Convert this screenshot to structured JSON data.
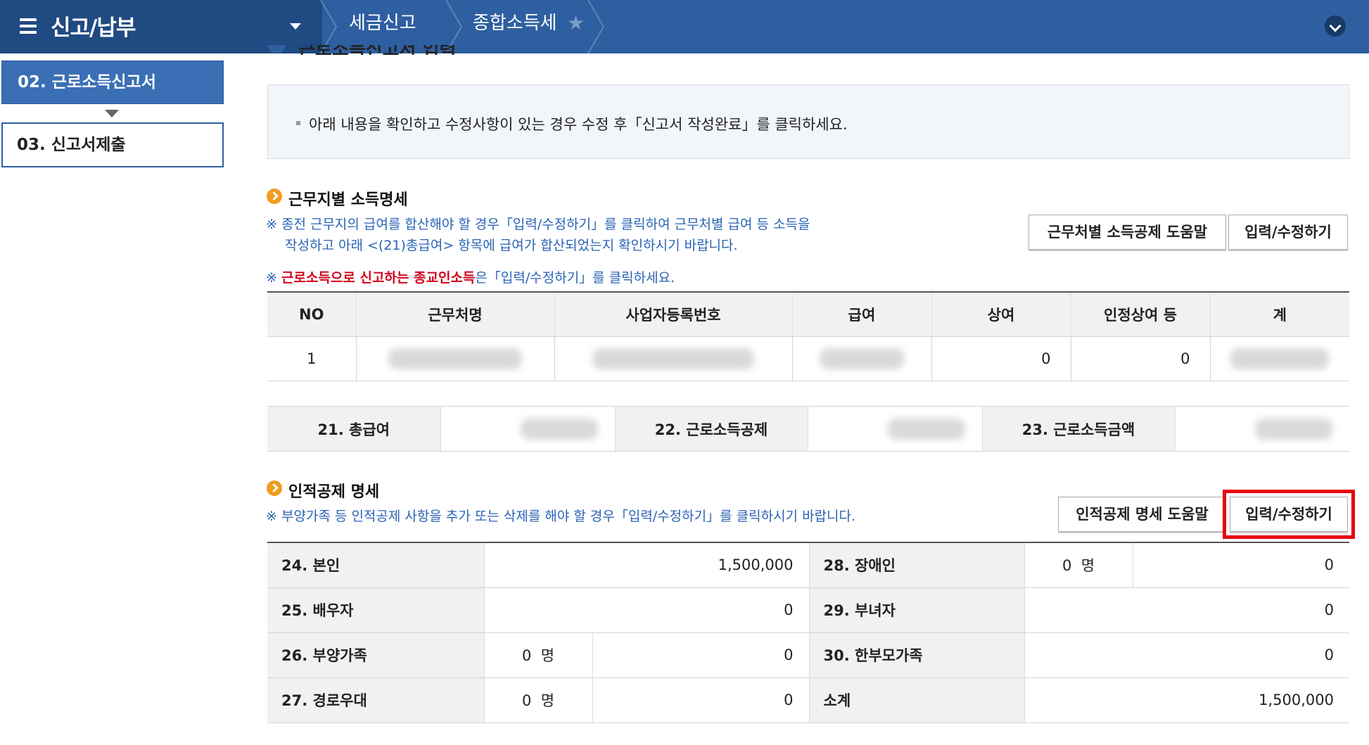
{
  "header": {
    "title": "신고/납부",
    "breadcrumb": [
      "세금신고",
      "종합소득세"
    ]
  },
  "sidebar": {
    "steps": [
      {
        "label": "02.  근로소득신고서"
      },
      {
        "label": "03.  신고서제출"
      }
    ]
  },
  "section_cut": {
    "title": "근로소득신고서 입력"
  },
  "info": {
    "text": "아래 내용을 확인하고 수정사항이 있는 경우 수정 후「신고서 작성완료」를 클릭하세요."
  },
  "income": {
    "title": "근무지별 소득명세",
    "note1": "※ 종전 근무지의 급여를 합산해야 할 경우「입력/수정하기」를 클릭하여 근무처별 급여 등 소득을",
    "note2": "작성하고 아래 <(21)총급여> 항목에 급여가 합산되었는지 확인하시기 바랍니다.",
    "note3_prefix": "※ ",
    "note3_red": "근로소득으로 신고하는 종교인소득",
    "note3_suffix": "은「입력/수정하기」를 클릭하세요.",
    "help_button": "근무처별 소득공제 도움말",
    "edit_button": "입력/수정하기",
    "columns": [
      "NO",
      "근무처명",
      "사업자등록번호",
      "급여",
      "상여",
      "인정상여 등",
      "계"
    ],
    "rows": [
      {
        "no": "1",
        "bonus": "0",
        "recognized_bonus": "0"
      }
    ]
  },
  "summary": {
    "total_salary_label": "21. 총급여",
    "deduction_label": "22. 근로소득공제",
    "income_amount_label": "23. 근로소득금액"
  },
  "personal": {
    "title": "인적공제 명세",
    "note": "※ 부양가족 등 인적공제 사항을 추가 또는 삭제를 해야 할 경우「입력/수정하기」를 클릭하시기 바랍니다.",
    "help_button": "인적공제 명세 도움말",
    "edit_button": "입력/수정하기",
    "unit": "명",
    "self_label": "24. 본인",
    "self_value": "1,500,000",
    "disabled_label": "28. 장애인",
    "disabled_count": "0",
    "disabled_value": "0",
    "spouse_label": "25. 배우자",
    "spouse_value": "0",
    "woman_label": "29. 부녀자",
    "woman_value": "0",
    "dependents_label": "26. 부양가족",
    "dependents_count": "0",
    "dependents_value": "0",
    "single_parent_label": "30. 한부모가족",
    "single_parent_value": "0",
    "elderly_label": "27. 경로우대",
    "elderly_count": "0",
    "elderly_value": "0",
    "subtotal_label": "소계",
    "subtotal_value": "1,500,000"
  }
}
